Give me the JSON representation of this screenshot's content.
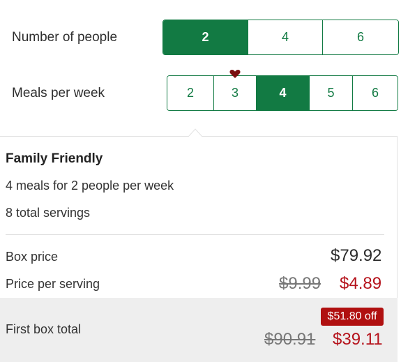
{
  "people": {
    "label": "Number of people",
    "options": [
      "2",
      "4",
      "6"
    ],
    "selected": "2"
  },
  "meals": {
    "label": "Meals per week",
    "options": [
      "2",
      "3",
      "4",
      "5",
      "6"
    ],
    "selected": "4",
    "favorite": "3"
  },
  "plan": {
    "name": "Family Friendly",
    "summary": "4 meals for 2 people per week",
    "servings": "8 total servings"
  },
  "pricing": {
    "box_price_label": "Box price",
    "box_price": "$79.92",
    "per_serving_label": "Price per serving",
    "per_serving_original": "$9.99",
    "per_serving_discounted": "$4.89",
    "first_box_label": "First box total",
    "first_box_original": "$90.91",
    "first_box_discounted": "$39.11",
    "discount_badge": "$51.80 off"
  },
  "colors": {
    "accent": "#127a43",
    "sale": "#b5121b",
    "badge": "#b01010",
    "heart": "#7a1010"
  }
}
